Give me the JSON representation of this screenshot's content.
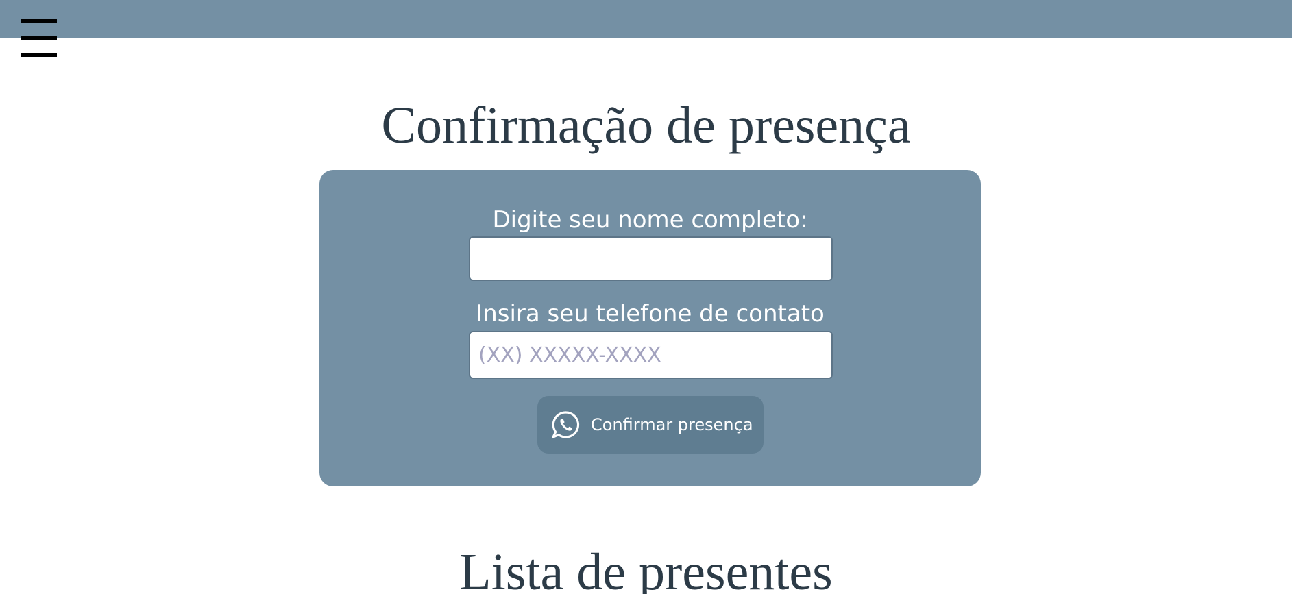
{
  "header": {
    "menu_icon": "hamburger-menu-icon"
  },
  "rsvp": {
    "title": "Confirmação de presença",
    "name_label": "Digite seu nome completo:",
    "name_value": "",
    "phone_label": "Insira seu telefone de contato",
    "phone_placeholder": "(XX) XXXXX-XXXX",
    "phone_value": "",
    "button_icon": "whatsapp-icon",
    "button_label": "Confirmar presença"
  },
  "gifts": {
    "title": "Lista de presentes"
  },
  "colors": {
    "primary": "#7490a4",
    "button": "#5f7d91",
    "heading": "#2c3b47",
    "placeholder": "#a3a3bf"
  }
}
